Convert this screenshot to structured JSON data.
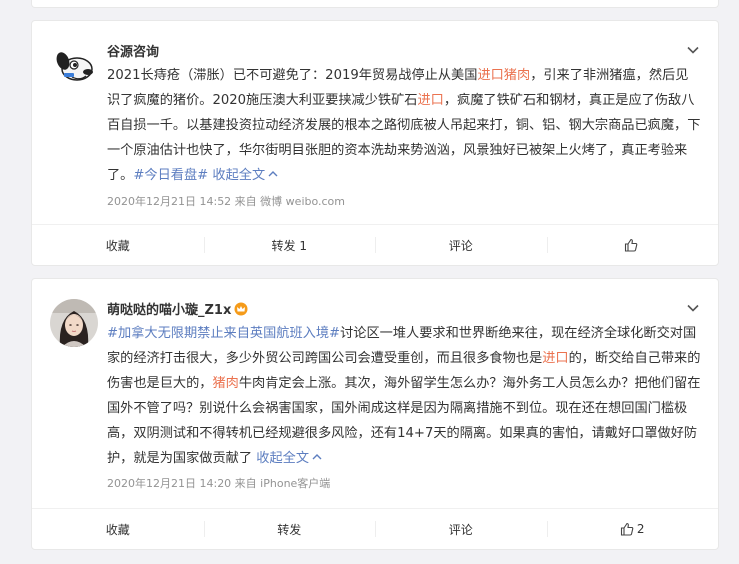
{
  "posts": [
    {
      "username": "谷源咨询",
      "content": [
        {
          "t": "2021长痔疮（滞胀）已不可避免了：2019年贸易战停止从美国",
          "c": "text"
        },
        {
          "t": "进口猪肉",
          "c": "hl"
        },
        {
          "t": "，引来了非洲猪瘟，然后见识了疯魔的猪价。2020施压澳大利亚要挟减少铁矿石",
          "c": "text"
        },
        {
          "t": "进口",
          "c": "hl"
        },
        {
          "t": "，疯魔了铁矿石和钢材，真正是应了伤敌八百自损一千。以基建投资拉动经济发展的根本之路彻底被人吊起来打，铜、铝、钢大宗商品已疯魔，下一个原油估计也快了，华尔街明目张胆的资本洗劫来势汹汹，风景独好已被架上火烤了，真正考验来了。",
          "c": "text"
        },
        {
          "t": "#今日看盘#",
          "c": "lk"
        },
        {
          "t": " 收起全文",
          "c": "lk"
        }
      ],
      "meta": "2020年12月21日 14:52  来自 微博 weibo.com",
      "actions": {
        "collect": "收藏",
        "repost": "转发 1",
        "comment": "评论",
        "like": ""
      }
    },
    {
      "username": "萌哒哒的喵小璇_Z1x",
      "content": [
        {
          "t": "#加拿大无限期禁止来自英国航班入境#",
          "c": "lk"
        },
        {
          "t": "讨论区一堆人要求和世界断绝来往，现在经济全球化断交对国家的经济打击很大，多少外贸公司跨国公司会遭受重创，而且很多食物也是",
          "c": "text"
        },
        {
          "t": "进口",
          "c": "hl"
        },
        {
          "t": "的，断交给自己带来的伤害也是巨大的，",
          "c": "text"
        },
        {
          "t": "猪肉",
          "c": "hl"
        },
        {
          "t": "牛肉肯定会上涨。其次，海外留学生怎么办？海外务工人员怎么办？把他们留在国外不管了吗？别说什么会祸害国家，国外闹成这样是因为隔离措施不到位。现在还在想回国门槛极高，双阴测试和不得转机已经规避很多风险，还有14+7天的隔离。如果真的害怕，请戴好口罩做好防护，就是为国家做贡献了",
          "c": "text"
        },
        {
          "t": " 收起全文",
          "c": "lk"
        }
      ],
      "meta": "2020年12月21日 14:20  来自 iPhone客户端",
      "actions": {
        "collect": "收藏",
        "repost": "转发",
        "comment": "评论",
        "like": "2"
      }
    }
  ],
  "icons": {
    "chevron": "chevron-down-icon",
    "like": "thumbs-up-icon",
    "collapse": "chevron-up-icon",
    "crown": "crown-icon"
  },
  "colors": {
    "highlight": "#eb7350",
    "link": "#5d7ec0",
    "meta": "#939393"
  }
}
